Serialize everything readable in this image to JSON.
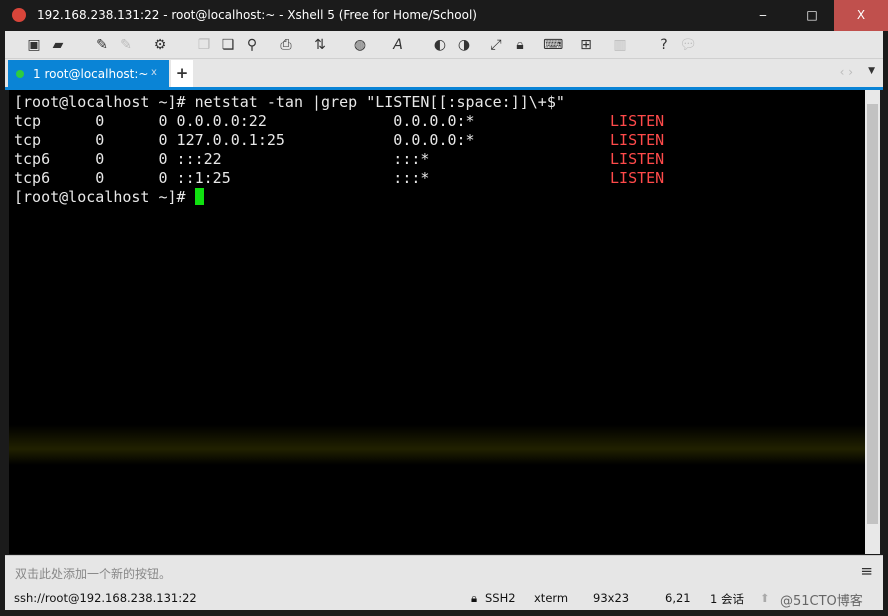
{
  "window": {
    "title": "192.168.238.131:22 - root@localhost:~ - Xshell 5 (Free for Home/School)",
    "minimize": "‒",
    "maximize": "□",
    "close": "X"
  },
  "toolbar": {
    "icons": [
      "new-session-icon",
      "open-folder-icon",
      "connect-icon",
      "disconnect-icon",
      "properties-icon",
      "copy-icon",
      "paste-icon",
      "find-icon",
      "print-icon",
      "transfer-icon",
      "globe-icon",
      "font-icon",
      "xftp-icon",
      "xmanager-icon",
      "fullscreen-icon",
      "lock-icon",
      "keyboard-icon",
      "add-tab-icon",
      "layout-icon",
      "help-icon",
      "chat-icon"
    ]
  },
  "tabs": [
    {
      "label": "1 root@localhost:~",
      "close": "x"
    }
  ],
  "new_tab": "+",
  "terminal": {
    "prompt_line": "[root@localhost ~]# netstat -tan |grep \"LISTEN[[:space:]]\\+$\"",
    "rows": [
      {
        "proto": "tcp",
        "recv": "0",
        "send": "0",
        "local": "0.0.0.0:22",
        "foreign": "0.0.0.0:*",
        "state": "LISTEN"
      },
      {
        "proto": "tcp",
        "recv": "0",
        "send": "0",
        "local": "127.0.0.1:25",
        "foreign": "0.0.0.0:*",
        "state": "LISTEN"
      },
      {
        "proto": "tcp6",
        "recv": "0",
        "send": "0",
        "local": ":::22",
        "foreign": ":::*",
        "state": "LISTEN"
      },
      {
        "proto": "tcp6",
        "recv": "0",
        "send": "0",
        "local": "::1:25",
        "foreign": ":::*",
        "state": "LISTEN"
      }
    ],
    "last_prompt": "[root@localhost ~]# ",
    "state_color": "#ff4a4a",
    "cursor_color": "#10e010"
  },
  "quickbar": {
    "hint": "双击此处添加一个新的按钮。",
    "menu": "≡"
  },
  "status": {
    "address": "ssh://root@192.168.238.131:22",
    "protocol": "SSH2",
    "term": "xterm",
    "size": "93x23",
    "cursor": "6,21",
    "sessions": "1 会话",
    "watermark": "@51CTO博客"
  }
}
